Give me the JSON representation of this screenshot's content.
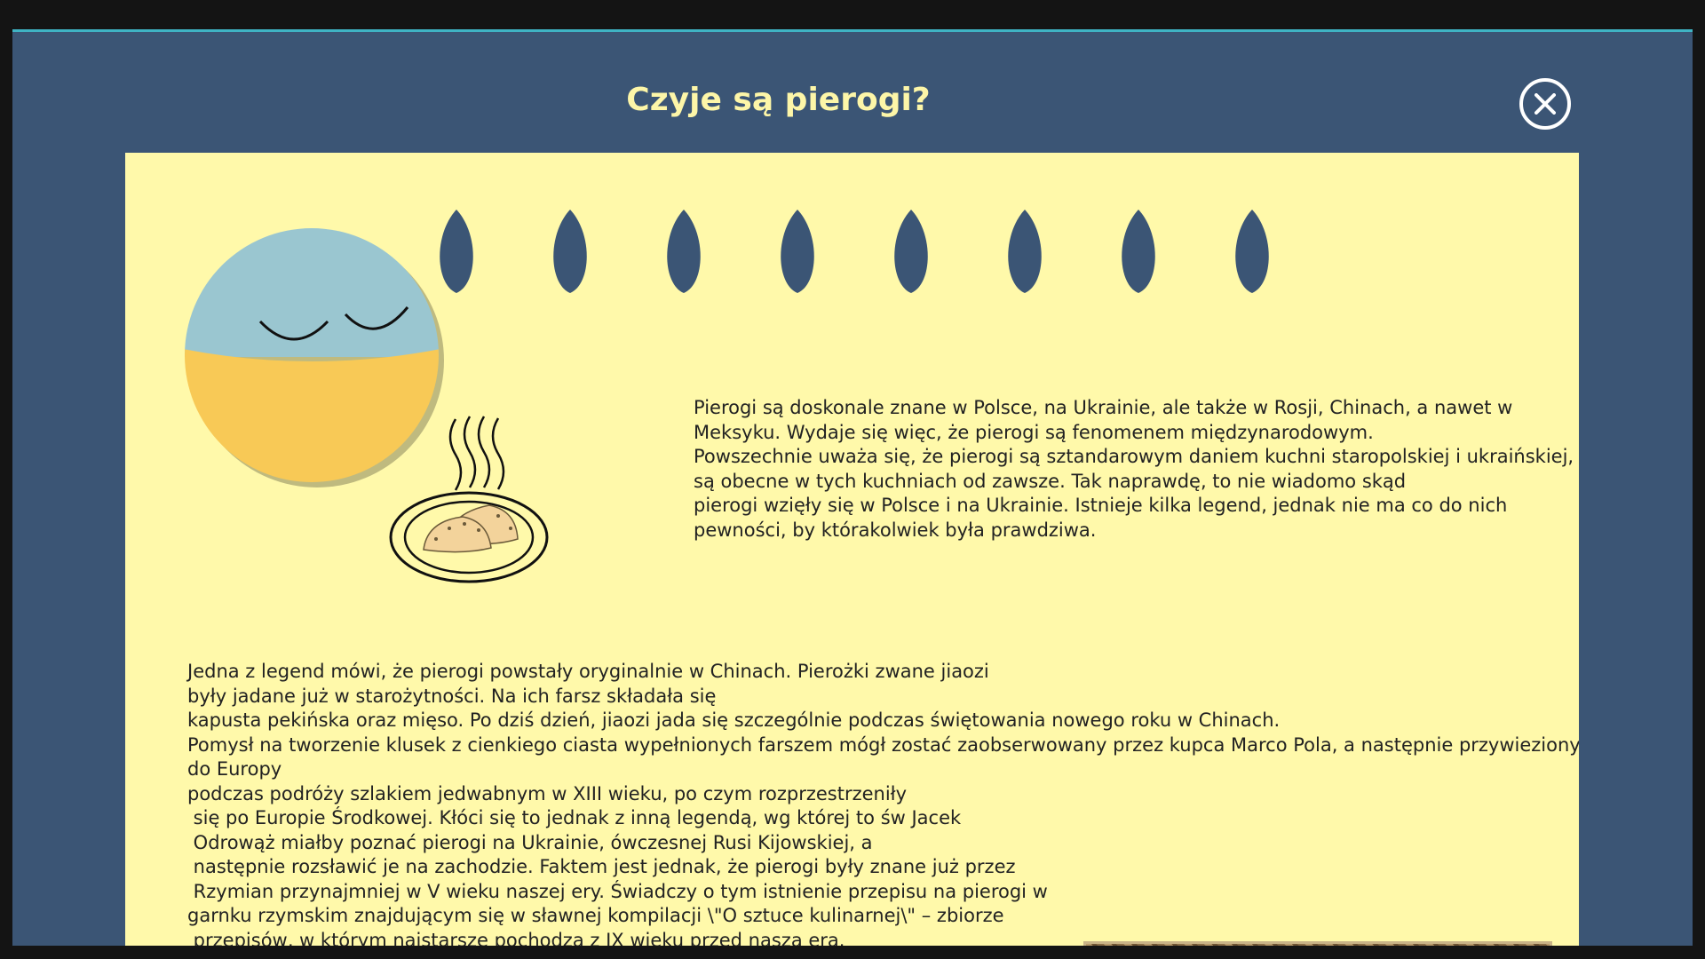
{
  "modal": {
    "title": "Czyje są pierogi?",
    "close_icon": "close-icon"
  },
  "colors": {
    "modal_bg": "#3b5575",
    "panel_bg": "#fff9aa",
    "title": "#fdf6a8",
    "accent_line": "#3fb3c4",
    "drop": "#3b5575",
    "ball_blue": "#9ac6d0",
    "ball_yellow": "#f8c956"
  },
  "illustration": {
    "character": "ukraine-ball-character",
    "plate": "pierogi-plate",
    "drops": [
      "drop",
      "drop",
      "drop",
      "drop",
      "drop",
      "drop",
      "drop",
      "drop"
    ]
  },
  "content": {
    "intro_lines": [
      "Pierogi są doskonale znane w Polsce, na Ukrainie, ale także w Rosji, Chinach, a nawet w",
      "Meksyku. Wydaje się więc, że pierogi są fenomenem międzynarodowym.",
      "Powszechnie uważa się, że pierogi są sztandarowym daniem kuchni staropolskiej i ukraińskiej, które",
      "są obecne w tych kuchniach od zawsze. Tak naprawdę, to nie wiadomo skąd",
      "pierogi wzięły się w Polsce i na Ukrainie. Istnieje kilka legend, jednak nie ma co do nich",
      "pewności, by którakolwiek była prawdziwa."
    ],
    "legend_lines": [
      "Jedna z legend mówi, że pierogi powstały oryginalnie w Chinach. Pierożki zwane jiaozi",
      "były jadane już w starożytności. Na ich farsz składała się",
      "kapusta pekińska oraz mięso. Po dziś dzień, jiaozi jada się szczególnie podczas świętowania nowego roku w Chinach.",
      "Pomysł na tworzenie klusek z cienkiego ciasta wypełnionych farszem mógł zostać zaobserwowany przez kupca Marco Pola, a następnie przywieziony",
      "do Europy",
      "podczas podróży szlakiem jedwabnym w XIII wieku, po czym rozprzestrzeniły",
      " się po Europie Środkowej. Kłóci się to jednak z inną legendą, wg której to św Jacek",
      " Odrowąż miałby poznać pierogi na Ukrainie, ówczesnej Rusi Kijowskiej, a",
      " następnie rozsławić je na zachodzie. Faktem jest jednak, że pierogi były znane już przez",
      " Rzymian przynajmniej w V wieku naszej ery. Świadczy o tym istnienie przepisu na pierogi w",
      "garnku rzymskim znajdującym się w sławnej kompilacji \\\"O sztuce kulinarnej\\\" – zbiorze",
      " przepisów, w którym najstarsze pochodzą z IX wieku przed naszą erą."
    ]
  }
}
